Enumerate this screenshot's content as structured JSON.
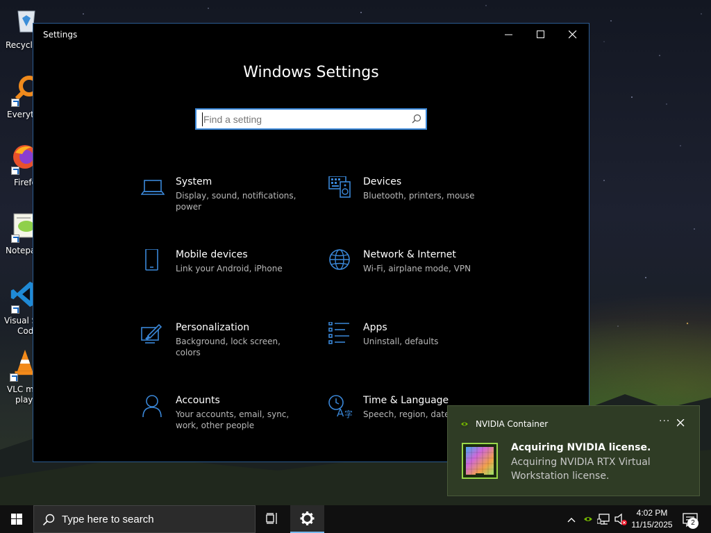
{
  "desktop": {
    "icons": [
      {
        "label": "Recycle"
      },
      {
        "label": "Everyth"
      },
      {
        "label": "Firefo"
      },
      {
        "label": "Notepa"
      },
      {
        "label_line1": "Visual St",
        "label_line2": "Cod"
      },
      {
        "label_line1": "VLC me",
        "label_line2": "playe"
      }
    ]
  },
  "window": {
    "title": "Settings",
    "heading": "Windows Settings",
    "search_placeholder": "Find a setting",
    "accent": "#3a87d8",
    "categories": [
      {
        "name": "System",
        "desc": "Display, sound, notifications, power",
        "icon": "laptop-icon"
      },
      {
        "name": "Devices",
        "desc": "Bluetooth, printers, mouse",
        "icon": "keyboard-speaker-icon"
      },
      {
        "name": "Mobile devices",
        "desc": "Link your Android, iPhone",
        "icon": "phone-icon"
      },
      {
        "name": "Network & Internet",
        "desc": "Wi-Fi, airplane mode, VPN",
        "icon": "globe-icon"
      },
      {
        "name": "Personalization",
        "desc": "Background, lock screen, colors",
        "icon": "brush-icon"
      },
      {
        "name": "Apps",
        "desc": "Uninstall, defaults",
        "icon": "apps-list-icon"
      },
      {
        "name": "Accounts",
        "desc": "Your accounts, email, sync, work, other people",
        "icon": "person-icon"
      },
      {
        "name": "Time & Language",
        "desc": "Speech, region, date",
        "icon": "time-language-icon"
      }
    ]
  },
  "notification": {
    "app": "NVIDIA Container",
    "more": "···",
    "title": "Acquiring NVIDIA license.",
    "body": "Acquiring NVIDIA RTX Virtual Workstation license."
  },
  "taskbar": {
    "search_placeholder": "Type here to search",
    "time": "4:02 PM",
    "date": "11/15/2025",
    "notification_count": "2"
  }
}
